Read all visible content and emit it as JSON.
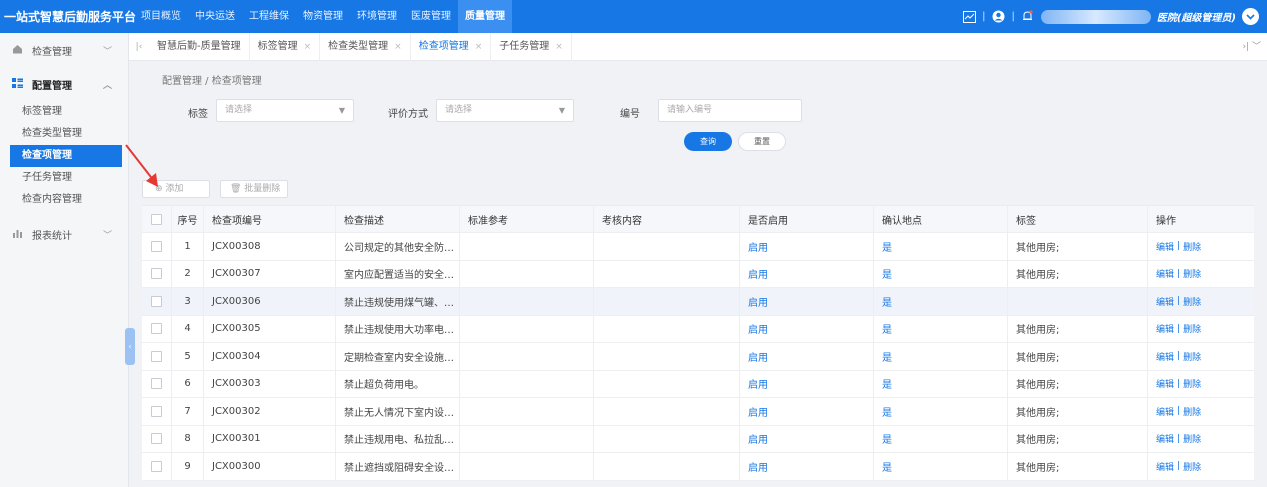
{
  "app": {
    "brand": "一站式智慧后勤服务平台",
    "nav": [
      "项目概览",
      "中央运送",
      "工程维保",
      "物资管理",
      "环境管理",
      "医废管理",
      "质量管理"
    ],
    "nav_active_index": 6,
    "user_suffix": "医院(超级管理员)",
    "separator": "|"
  },
  "sidebar": {
    "groups": [
      {
        "label": "检查管理",
        "icon": "home-icon",
        "caret": "﹀"
      },
      {
        "label": "配置管理",
        "icon": "grid-icon",
        "caret": "︿"
      },
      {
        "label": "报表统计",
        "icon": "chart-icon",
        "caret": "﹀"
      }
    ],
    "config_items": [
      "标签管理",
      "检查类型管理",
      "检查项管理",
      "子任务管理",
      "检查内容管理"
    ],
    "active_item": "检查项管理",
    "collapse_glyph": "‹"
  },
  "tabs": {
    "items": [
      {
        "label": "智慧后勤-质量管理",
        "closable": false
      },
      {
        "label": "标签管理",
        "closable": true
      },
      {
        "label": "检查类型管理",
        "closable": true
      },
      {
        "label": "检查项管理",
        "closable": true,
        "active": true
      },
      {
        "label": "子任务管理",
        "closable": true
      }
    ],
    "left_glyph": "|‹",
    "right_glyph": "›|  ﹀",
    "close_glyph": "×"
  },
  "breadcrumb": "配置管理  /  检查项管理",
  "filter": {
    "tag_label": "标签",
    "tag_placeholder": "请选择",
    "eval_label": "评价方式",
    "eval_placeholder": "请选择",
    "code_label": "编号",
    "code_placeholder": "请输入编号",
    "query_label": "查询",
    "reset_label": "重置",
    "dropdown_glyph": "▼"
  },
  "actions": {
    "add_label": "⊕ 添加",
    "batch_delete_label": "🗑 批量删除"
  },
  "table": {
    "headers": [
      "序号",
      "检查项编号",
      "检查描述",
      "标准参考",
      "考核内容",
      "是否启用",
      "确认地点",
      "标签",
      "操作"
    ],
    "rows": [
      {
        "seq": "1",
        "code": "JCX00308",
        "desc": "公司规定的其他安全防…",
        "std": "",
        "exam": "",
        "enabled": "启用",
        "loc": "是",
        "tag": "其他用房;",
        "edit": "编辑",
        "delete": "删除"
      },
      {
        "seq": "2",
        "code": "JCX00307",
        "desc": "室内应配置适当的安全…",
        "std": "",
        "exam": "",
        "enabled": "启用",
        "loc": "是",
        "tag": "其他用房;",
        "edit": "编辑",
        "delete": "删除"
      },
      {
        "seq": "3",
        "code": "JCX00306",
        "desc": "禁止违规使用煤气罐、…",
        "std": "",
        "exam": "",
        "enabled": "启用",
        "loc": "是",
        "tag": "",
        "edit": "编辑",
        "delete": "删除"
      },
      {
        "seq": "4",
        "code": "JCX00305",
        "desc": "禁止违规使用大功率电…",
        "std": "",
        "exam": "",
        "enabled": "启用",
        "loc": "是",
        "tag": "其他用房;",
        "edit": "编辑",
        "delete": "删除"
      },
      {
        "seq": "5",
        "code": "JCX00304",
        "desc": "定期检查室内安全设施…",
        "std": "",
        "exam": "",
        "enabled": "启用",
        "loc": "是",
        "tag": "其他用房;",
        "edit": "编辑",
        "delete": "删除"
      },
      {
        "seq": "6",
        "code": "JCX00303",
        "desc": "禁止超负荷用电。",
        "std": "",
        "exam": "",
        "enabled": "启用",
        "loc": "是",
        "tag": "其他用房;",
        "edit": "编辑",
        "delete": "删除"
      },
      {
        "seq": "7",
        "code": "JCX00302",
        "desc": "禁止无人情况下室内设…",
        "std": "",
        "exam": "",
        "enabled": "启用",
        "loc": "是",
        "tag": "其他用房;",
        "edit": "编辑",
        "delete": "删除"
      },
      {
        "seq": "8",
        "code": "JCX00301",
        "desc": "禁止违规用电、私拉乱…",
        "std": "",
        "exam": "",
        "enabled": "启用",
        "loc": "是",
        "tag": "其他用房;",
        "edit": "编辑",
        "delete": "删除"
      },
      {
        "seq": "9",
        "code": "JCX00300",
        "desc": "禁止遮挡或阻碍安全设…",
        "std": "",
        "exam": "",
        "enabled": "启用",
        "loc": "是",
        "tag": "其他用房;",
        "edit": "编辑",
        "delete": "删除"
      }
    ],
    "highlight_row_index": 2,
    "op_separator": "|"
  },
  "colors": {
    "primary": "#1677e5",
    "annotation_arrow": "#e53935"
  }
}
